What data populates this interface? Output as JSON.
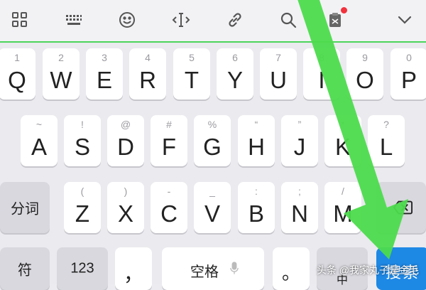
{
  "toolbar": {
    "icons": [
      "grid-icon",
      "keyboard-icon",
      "emoji-icon",
      "cursor-icon",
      "link-icon",
      "search-icon",
      "clipboard-icon",
      "chevron-down-icon"
    ],
    "notification_color": "#f2323c"
  },
  "rows": {
    "row1": [
      {
        "hint": "1",
        "key": "Q"
      },
      {
        "hint": "2",
        "key": "W"
      },
      {
        "hint": "3",
        "key": "E"
      },
      {
        "hint": "4",
        "key": "R"
      },
      {
        "hint": "5",
        "key": "T"
      },
      {
        "hint": "6",
        "key": "Y"
      },
      {
        "hint": "7",
        "key": "U"
      },
      {
        "hint": "8",
        "key": "I"
      },
      {
        "hint": "9",
        "key": "O"
      },
      {
        "hint": "0",
        "key": "P"
      }
    ],
    "row2": [
      {
        "hint": "~",
        "key": "A"
      },
      {
        "hint": "!",
        "key": "S"
      },
      {
        "hint": "@",
        "key": "D"
      },
      {
        "hint": "#",
        "key": "F"
      },
      {
        "hint": "%",
        "key": "G"
      },
      {
        "hint": "“",
        "key": "H"
      },
      {
        "hint": "”",
        "key": "J"
      },
      {
        "hint": "*",
        "key": "K"
      },
      {
        "hint": "?",
        "key": "L"
      }
    ],
    "row3": [
      {
        "hint": "(",
        "key": "Z"
      },
      {
        "hint": ")",
        "key": "X"
      },
      {
        "hint": "-",
        "key": "C"
      },
      {
        "hint": "_",
        "key": "V"
      },
      {
        "hint": ":",
        "key": "B"
      },
      {
        "hint": ";",
        "key": "N"
      },
      {
        "hint": "/",
        "key": "M"
      }
    ]
  },
  "keys": {
    "segment": "分词",
    "symbol": "符",
    "numeric": "123",
    "comma": "，",
    "space": "空格",
    "period": "。",
    "lang_sub": "中",
    "search": "搜索"
  },
  "colors": {
    "accent_green": "#4cd55a",
    "search_blue": "#1e88e5"
  },
  "watermark": "头条 @我家丸子是金毛"
}
